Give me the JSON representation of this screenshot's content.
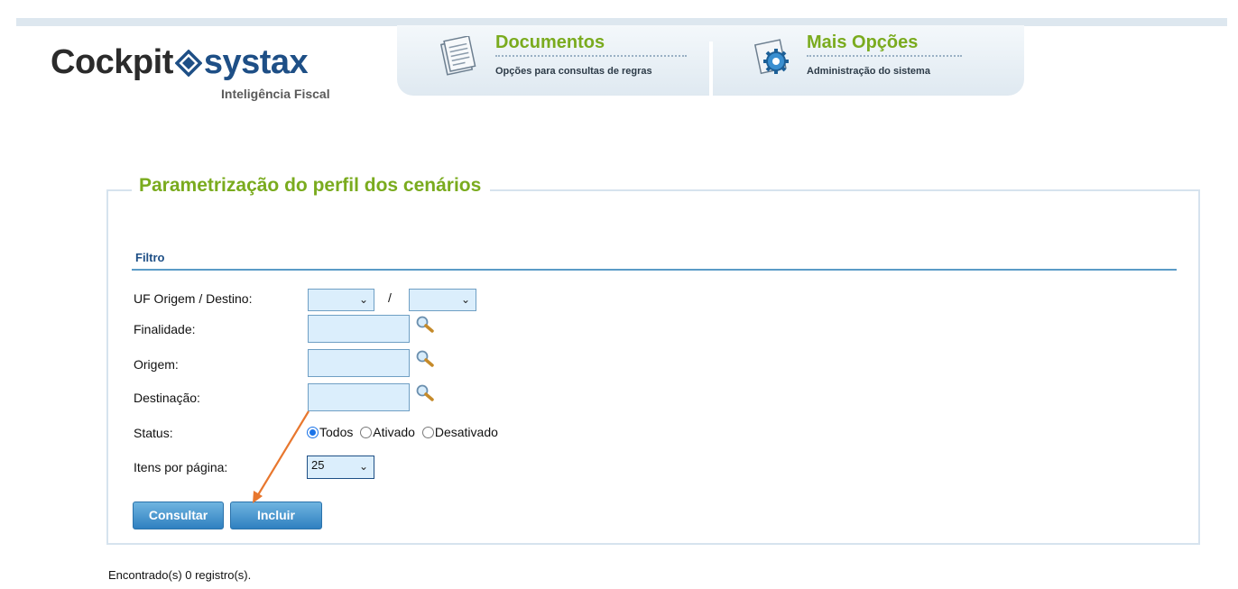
{
  "header": {
    "logo": {
      "part1": "Cockpit",
      "part2": "systax",
      "tagline": "Inteligência Fiscal"
    },
    "tabs": [
      {
        "title": "Documentos",
        "subtitle": "Opções para consultas de regras",
        "icon": "documents-icon"
      },
      {
        "title": "Mais Opções",
        "subtitle": "Administração do sistema",
        "icon": "settings-gear-icon"
      }
    ]
  },
  "form": {
    "title": "Parametrização do perfil dos cenários",
    "section": "Filtro",
    "labels": {
      "uf": "UF Origem / Destino:",
      "finalidade": "Finalidade:",
      "origem": "Origem:",
      "destinacao": "Destinação:",
      "status": "Status:",
      "itens": "Itens por página:"
    },
    "uf_separator": "/",
    "uf_origem_value": "",
    "uf_destino_value": "",
    "status_options": [
      "Todos",
      "Ativado",
      "Desativado"
    ],
    "status_selected": "Todos",
    "itens_value": "25",
    "buttons": {
      "consultar": "Consultar",
      "incluir": "Incluir"
    }
  },
  "footer": {
    "result": "Encontrado(s) 0 registro(s)."
  },
  "colors": {
    "accent_green": "#7aab1e",
    "brand_blue": "#1e4f86",
    "button_blue": "#2f80c0",
    "annotation_arrow": "#e8772e"
  }
}
